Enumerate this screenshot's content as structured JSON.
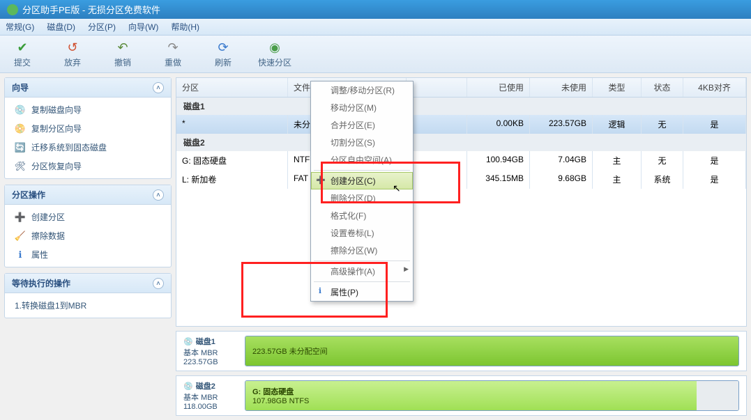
{
  "title": "分区助手PE版 - 无损分区免费软件",
  "menu": {
    "general": "常规(G)",
    "disk": "磁盘(D)",
    "partition": "分区(P)",
    "wizard": "向导(W)",
    "help": "帮助(H)"
  },
  "toolbar": {
    "commit": "提交",
    "discard": "放弃",
    "undo": "撤销",
    "redo": "重做",
    "refresh": "刷新",
    "quick": "快速分区"
  },
  "side": {
    "wizard": {
      "title": "向导",
      "copyDisk": "复制磁盘向导",
      "copyPart": "复制分区向导",
      "migrate": "迁移系统到固态磁盘",
      "recover": "分区恢复向导"
    },
    "ops": {
      "title": "分区操作",
      "create": "创建分区",
      "wipe": "擦除数据",
      "prop": "属性"
    },
    "pending": {
      "title": "等待执行的操作",
      "item1": "1.转换磁盘1到MBR"
    }
  },
  "grid": {
    "headers": {
      "part": "分区",
      "fs": "文件系统",
      "used": "已使用",
      "free": "未使用",
      "type": "类型",
      "status": "状态",
      "align": "4KB对齐"
    },
    "disk1": "磁盘1",
    "disk2": "磁盘2",
    "r1": {
      "name": "*",
      "fs": "未分",
      "used": "0.00KB",
      "free": "223.57GB",
      "type": "逻辑",
      "status": "无",
      "align": "是"
    },
    "r2": {
      "name": "G: 固态硬盘",
      "fs": "NTFS",
      "used": "100.94GB",
      "free": "7.04GB",
      "type": "主",
      "status": "无",
      "align": "是"
    },
    "r3": {
      "name": "L: 新加卷",
      "fs": "FAT",
      "used": "345.15MB",
      "free": "9.68GB",
      "type": "主",
      "status": "系统",
      "align": "是"
    }
  },
  "ctx": {
    "resize": "调整/移动分区(R)",
    "move": "移动分区(M)",
    "merge": "合并分区(E)",
    "split": "切割分区(S)",
    "free": "分区自由空间(A)",
    "create": "创建分区(C)",
    "delete": "删除分区(D)",
    "format": "格式化(F)",
    "label": "设置卷标(L)",
    "wipe": "擦除分区(W)",
    "adv": "高级操作(A)",
    "prop": "属性(P)"
  },
  "vis": {
    "d1": {
      "name": "磁盘1",
      "sub": "基本 MBR",
      "size": "223.57GB",
      "seg": "223.57GB 未分配空间"
    },
    "d2": {
      "name": "磁盘2",
      "sub": "基本 MBR",
      "size": "118.00GB",
      "segName": "G: 固态硬盘",
      "segInfo": "107.98GB NTFS"
    }
  }
}
